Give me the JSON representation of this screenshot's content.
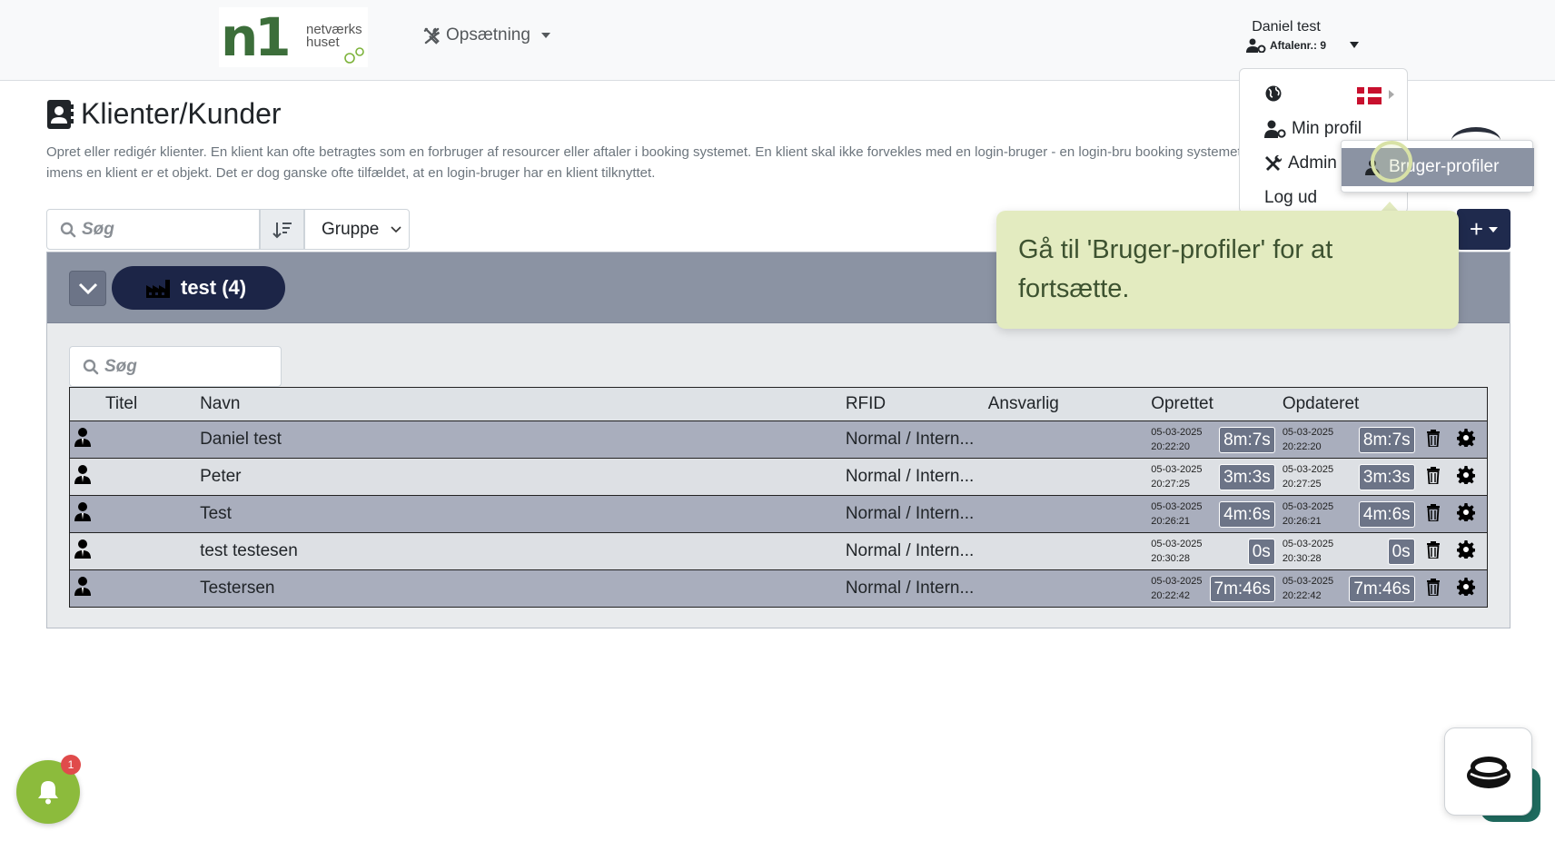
{
  "navbar": {
    "logo_text": "n1",
    "logo_sub_line1": "netværks",
    "logo_sub_line2": "huset",
    "setup_label": "Opsætning",
    "user_name": "Daniel test",
    "user_sub": "Aftalenr.: 9"
  },
  "page": {
    "title": "Klienter/Kunder",
    "description": "Opret eller redigér klienter. En klient kan ofte betragtes som en forbruger af resourcer eller aftaler i booking systemet. En klient skal ikke forvekles med en login-bruger - en login-bru booking systemet, imens en klient er et objekt. Det er dog ganske ofte tilfældet, at en login-bruger har en klient tilknyttet."
  },
  "toolbar": {
    "search_placeholder": "Søg",
    "group_select": "Gruppe",
    "add_label": "+"
  },
  "group": {
    "label": "test (4)",
    "search_placeholder": "Søg"
  },
  "table": {
    "headers": [
      "Titel",
      "Navn",
      "RFID",
      "Ansvarlig",
      "Oprettet",
      "Opdateret"
    ],
    "rows": [
      {
        "name": "Daniel test",
        "rfid": "Normal / Intern...",
        "created_date": "05-03-2025",
        "created_time": "20:22:20",
        "created_dur": "8m:7s",
        "updated_date": "05-03-2025",
        "updated_time": "20:22:20",
        "updated_dur": "8m:7s"
      },
      {
        "name": "Peter",
        "rfid": "Normal / Intern...",
        "created_date": "05-03-2025",
        "created_time": "20:27:25",
        "created_dur": "3m:3s",
        "updated_date": "05-03-2025",
        "updated_time": "20:27:25",
        "updated_dur": "3m:3s"
      },
      {
        "name": "Test",
        "rfid": "Normal / Intern...",
        "created_date": "05-03-2025",
        "created_time": "20:26:21",
        "created_dur": "4m:6s",
        "updated_date": "05-03-2025",
        "updated_time": "20:26:21",
        "updated_dur": "4m:6s"
      },
      {
        "name": "test testesen",
        "rfid": "Normal / Intern...",
        "created_date": "05-03-2025",
        "created_time": "20:30:28",
        "created_dur": "0s",
        "updated_date": "05-03-2025",
        "updated_time": "20:30:28",
        "updated_dur": "0s"
      },
      {
        "name": "Testersen",
        "rfid": "Normal / Intern...",
        "created_date": "05-03-2025",
        "created_time": "20:22:42",
        "created_dur": "7m:46s",
        "updated_date": "05-03-2025",
        "updated_time": "20:22:42",
        "updated_dur": "7m:46s"
      }
    ]
  },
  "user_menu": {
    "my_profile": "Min profil",
    "admin": "Admin",
    "logout": "Log ud",
    "submenu_item": "Bruger-profiler"
  },
  "tooltip": {
    "text": "Gå til 'Bruger-profiler' for at fortsætte."
  },
  "notifications": {
    "badge": "1"
  },
  "colors": {
    "navy": "#1c2547",
    "group_header": "#8b93a3",
    "tooltip_bg": "#e3ebc0",
    "bell": "#8cbb3c"
  }
}
